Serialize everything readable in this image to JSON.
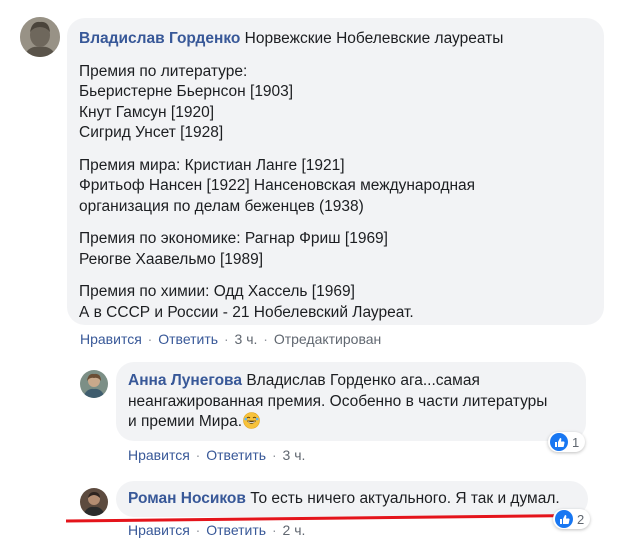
{
  "comments": [
    {
      "author": "Владислав Горденко",
      "title": "Норвежские Нобелевские лауреаты",
      "paragraphs": [
        [
          "Премия по литературе:",
          "Бьеристерне Бьернсон [1903]",
          "Кнут Гамсун [1920]",
          "Сигрид Унсет [1928]"
        ],
        [
          "Премия мира: Кристиан Ланге [1921]",
          "Фритьоф Нансен [1922] Нансеновская международная",
          "организация по делам беженцев (1938)"
        ],
        [
          "Премия по экономике: Рагнар Фриш [1969]",
          "Реюгве Хаавельмо [1989]"
        ],
        [
          "Премия по химии: Одд Хассель [1969]",
          "А в СССР и России - 21 Нобелевский Лауреат."
        ]
      ],
      "actions": {
        "like": "Нравится",
        "reply": "Ответить",
        "time": "3 ч.",
        "edited": "Отредактирован"
      }
    },
    {
      "author": "Анна Лунегова",
      "lines": [
        "Владислав Горденко ага...самая",
        "неангажированная премия. Особенно в части литературы",
        "и премии Мира."
      ],
      "emoji": "laughing-emoji",
      "reactions_count": "1",
      "actions": {
        "like": "Нравится",
        "reply": "Ответить",
        "time": "3 ч."
      }
    },
    {
      "author": "Роман Носиков",
      "text": "То есть ничего актуального. Я так и думал.",
      "reactions_count": "2",
      "actions": {
        "like": "Нравится",
        "reply": "Ответить",
        "time": "2 ч."
      }
    }
  ],
  "separator": "·",
  "colors": {
    "link": "#385898",
    "bubble": "#f2f3f5",
    "meta": "#606770",
    "like": "#1877f2",
    "underline": "#e4141b"
  }
}
